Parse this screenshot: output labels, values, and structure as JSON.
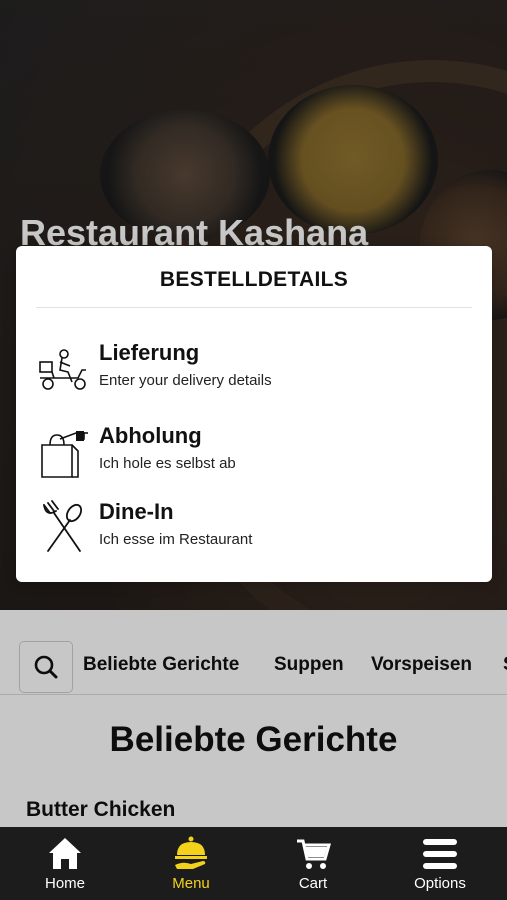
{
  "restaurant": {
    "name": "Restaurant Kashana"
  },
  "modal": {
    "title": "BESTELLDETAILS",
    "options": [
      {
        "title": "Lieferung",
        "subtitle": "Enter your delivery details",
        "icon": "delivery-scooter-icon"
      },
      {
        "title": "Abholung",
        "subtitle": "Ich hole es selbst ab",
        "icon": "takeaway-bag-icon"
      },
      {
        "title": "Dine-In",
        "subtitle": "Ich esse im Restaurant",
        "icon": "fork-spoon-icon"
      }
    ]
  },
  "categories": {
    "search_icon": "search-icon",
    "items": [
      "Beliebte Gerichte",
      "Suppen",
      "Vorspeisen",
      "S"
    ]
  },
  "menu": {
    "section_title": "Beliebte Gerichte",
    "first_item": "Butter Chicken"
  },
  "tabbar": {
    "active_color": "#f2d21b",
    "items": [
      {
        "label": "Home",
        "icon": "home-icon"
      },
      {
        "label": "Menu",
        "icon": "menu-cloche-icon"
      },
      {
        "label": "Cart",
        "icon": "cart-icon"
      },
      {
        "label": "Options",
        "icon": "hamburger-icon"
      }
    ]
  }
}
